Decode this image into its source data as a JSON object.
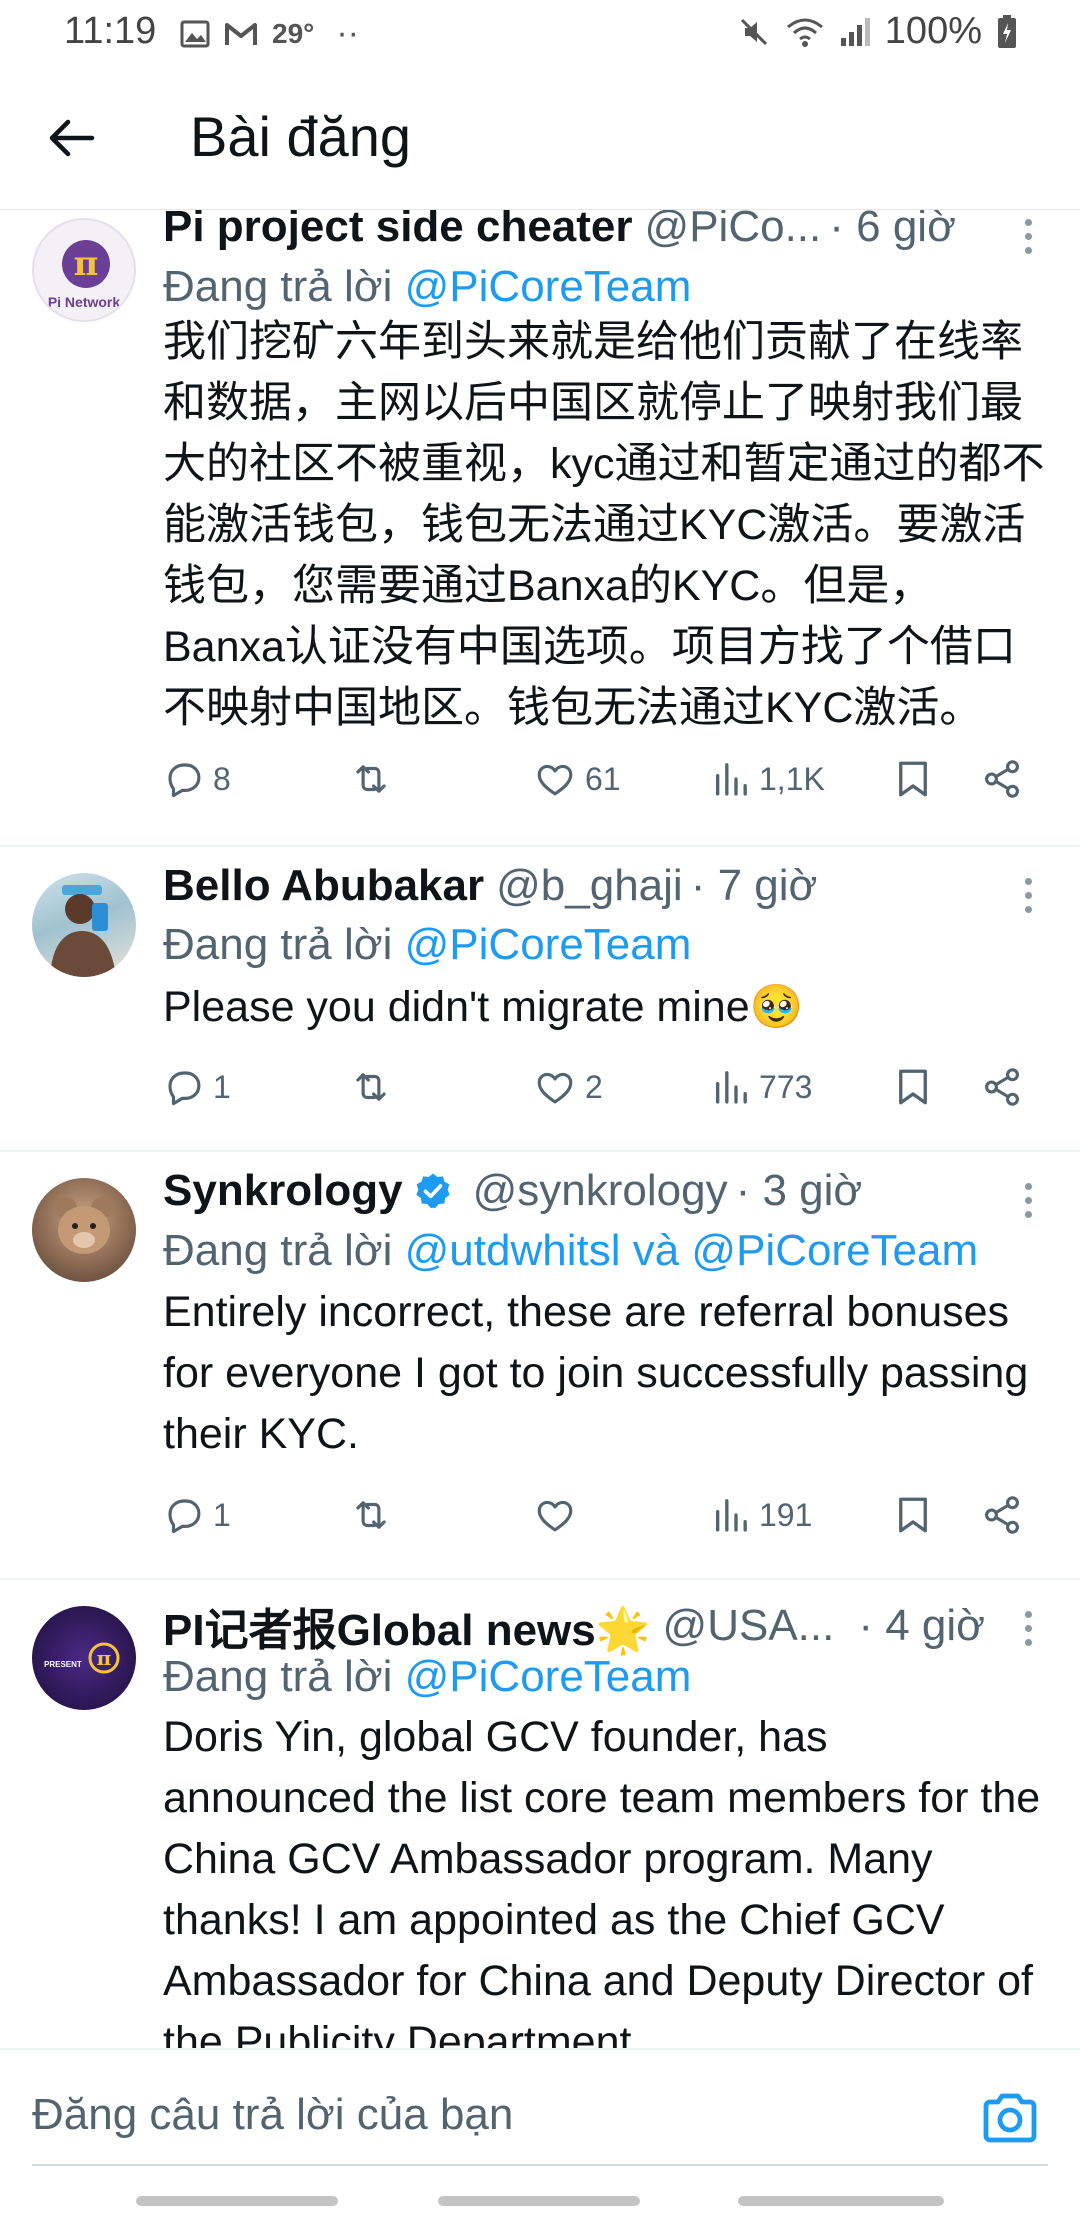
{
  "status_bar": {
    "time": "11:19",
    "temperature": "29°",
    "more_dots": "··",
    "battery": "100%"
  },
  "header": {
    "title": "Bài đăng"
  },
  "posts": [
    {
      "name": "Pi project side cheater",
      "handle": "@PiCo...",
      "time": "· 6 giờ",
      "reply_prefix": "Đang trả lời ",
      "reply_to": "@PiCoreTeam",
      "text": "我们挖矿六年到头来就是给他们贡献了在线率和数据，主网以后中国区就停止了映射我们最大的社区不被重视，kyc通过和暂定通过的都不能激活钱包，钱包无法通过KYC激活。要激活钱包，您需要通过Banxa的KYC。但是，Banxa认证没有中国选项。项目方找了个借口不映射中国地区。钱包无法通过KYC激活。",
      "replies": "8",
      "reposts": "",
      "likes": "61",
      "views": "1,1K",
      "avatar_label": "Pi Network"
    },
    {
      "name": "Bello Abubakar",
      "handle": "@b_ghaji",
      "time": "· 7 giờ",
      "reply_prefix": "Đang trả lời ",
      "reply_to": "@PiCoreTeam",
      "text": "Please you didn't migrate mine🥹",
      "replies": "1",
      "reposts": "",
      "likes": "2",
      "views": "773"
    },
    {
      "name": "Synkrology",
      "handle": "@synkrology",
      "time": "· 3 giờ",
      "reply_prefix": "Đang trả lời ",
      "reply_to": "@utdwhitsl và @PiCoreTeam",
      "text": "Entirely incorrect, these are referral bonuses for everyone I got to join successfully passing their KYC.",
      "replies": "1",
      "reposts": "",
      "likes": "",
      "views": "191"
    },
    {
      "name": "PI记者报Global news🌟",
      "handle": "@USA...",
      "time": "· 4 giờ",
      "reply_prefix": "Đang trả lời ",
      "reply_to": "@PiCoreTeam",
      "text": "Doris Yin, global GCV founder, has announced the list  core team members for the China GCV Ambassador program. Many thanks! I am appointed as the Chief GCV Ambassador for China and Deputy Director of the Publicity Department",
      "avatar_label": "PRESENT"
    }
  ],
  "compose": {
    "placeholder": "Đăng câu trả lời của bạn"
  },
  "colors": {
    "accent": "#1d9bf0",
    "secondary_text": "#536471",
    "primary_text": "#0f1419",
    "divider": "#eff3f4"
  },
  "icons": [
    "image-icon",
    "gmail-icon",
    "mute-icon",
    "wifi-icon",
    "signal-icon",
    "battery-charging-icon",
    "back-arrow-icon",
    "more-vert-icon",
    "reply-icon",
    "repost-icon",
    "like-icon",
    "views-icon",
    "bookmark-icon",
    "share-icon",
    "verified-badge-icon",
    "camera-icon"
  ]
}
